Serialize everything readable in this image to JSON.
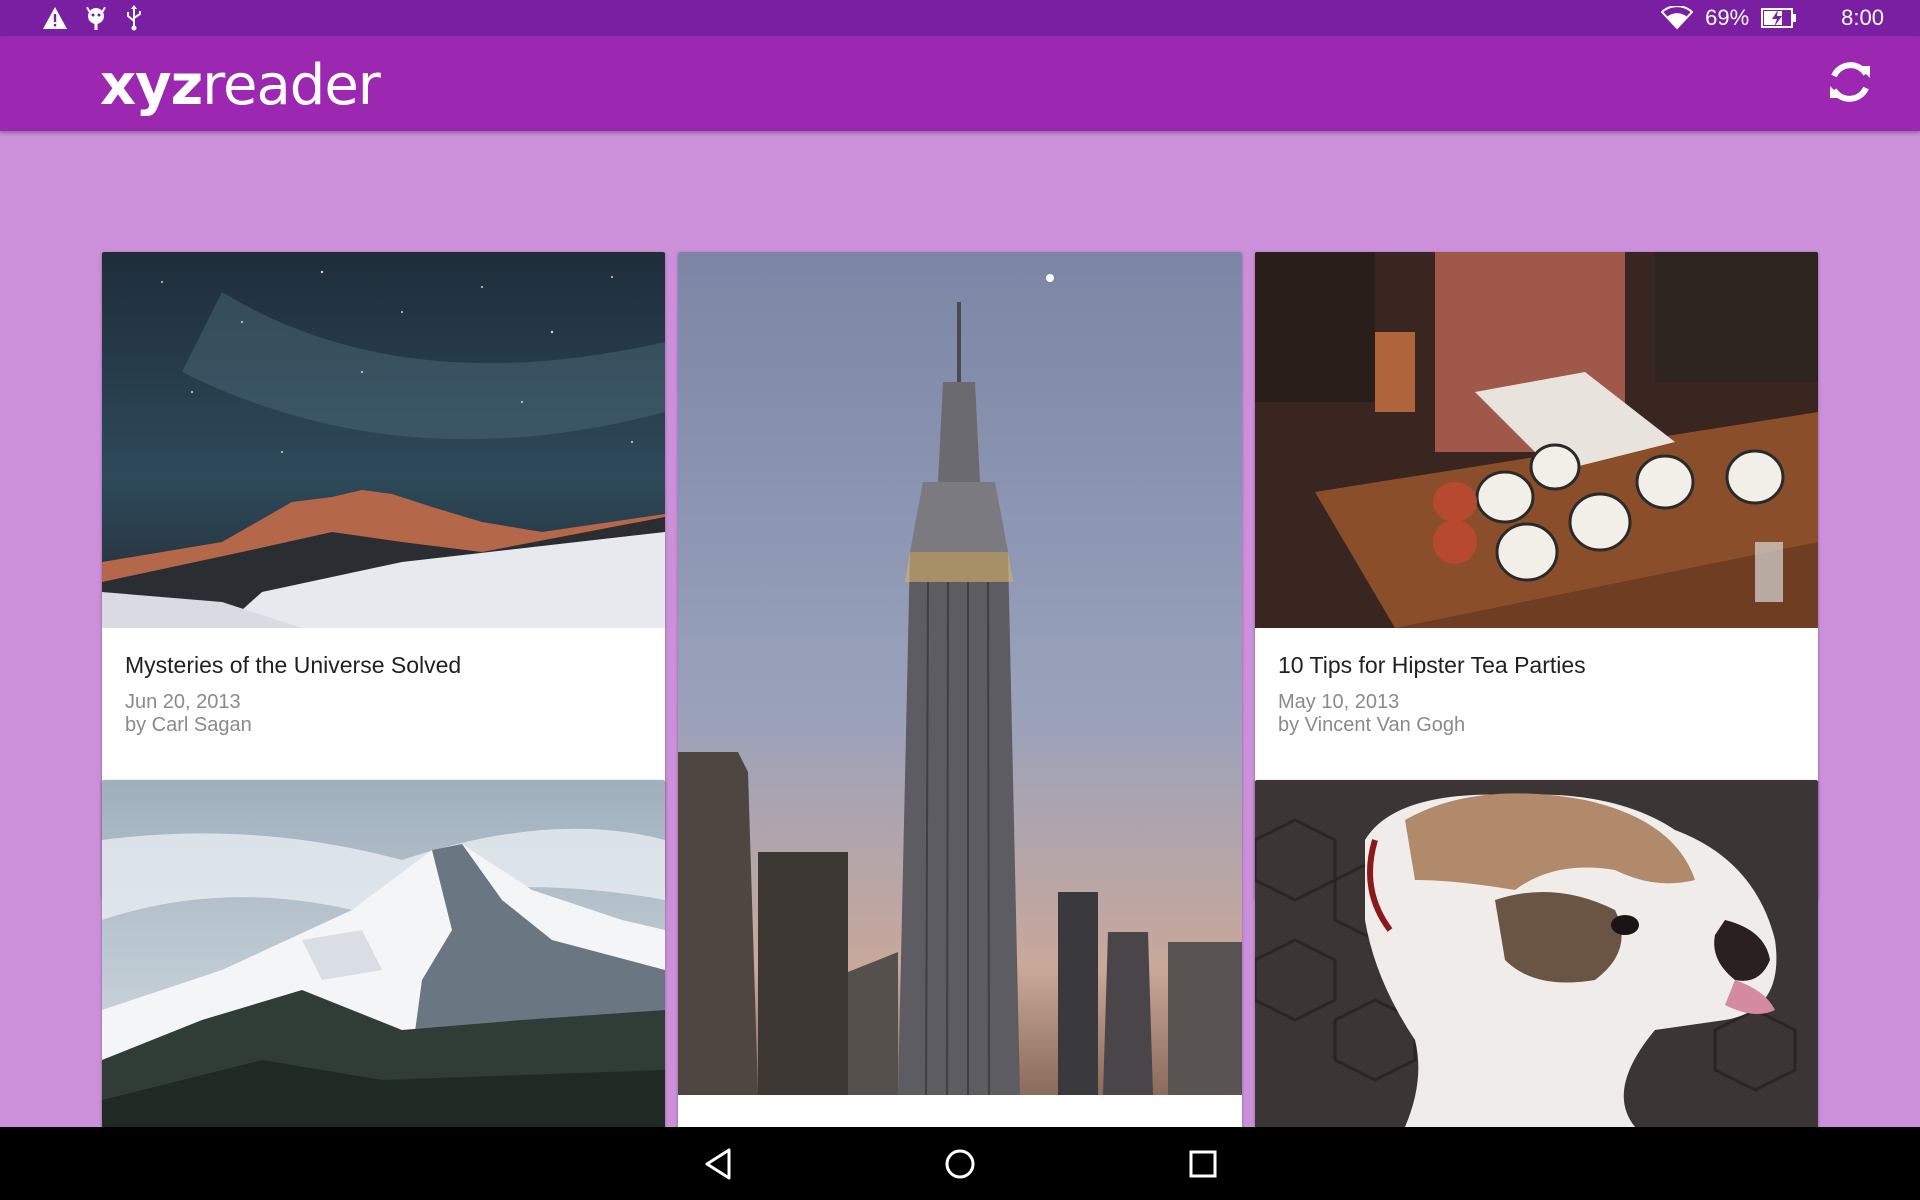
{
  "status_bar": {
    "icons_left": [
      "warning-icon",
      "android-debug-icon",
      "usb-icon"
    ],
    "battery_percent": "69%",
    "time": "8:00"
  },
  "app_bar": {
    "logo_bold": "xyz",
    "logo_regular": "reader",
    "refresh_icon": "refresh-icon"
  },
  "articles": [
    {
      "title": "Mysteries of the Universe Solved",
      "date": "Jun 20, 2013",
      "author": "by Carl Sagan",
      "image": "night sky over mountains"
    },
    {
      "title": "",
      "date": "",
      "author": "",
      "image": "empire state building skyline"
    },
    {
      "title": "10 Tips for Hipster Tea Parties",
      "date": "May 10, 2013",
      "author": "by Vincent Van Gogh",
      "image": "tea cups on wooden table"
    },
    {
      "title": "",
      "date": "",
      "author": "",
      "image": "snowy mountain ridge"
    },
    {
      "title": "",
      "date": "",
      "author": "",
      "image": "bulldog on cobblestones"
    }
  ],
  "nav_bar": {
    "back": "back-icon",
    "home": "home-icon",
    "recents": "recents-icon"
  }
}
